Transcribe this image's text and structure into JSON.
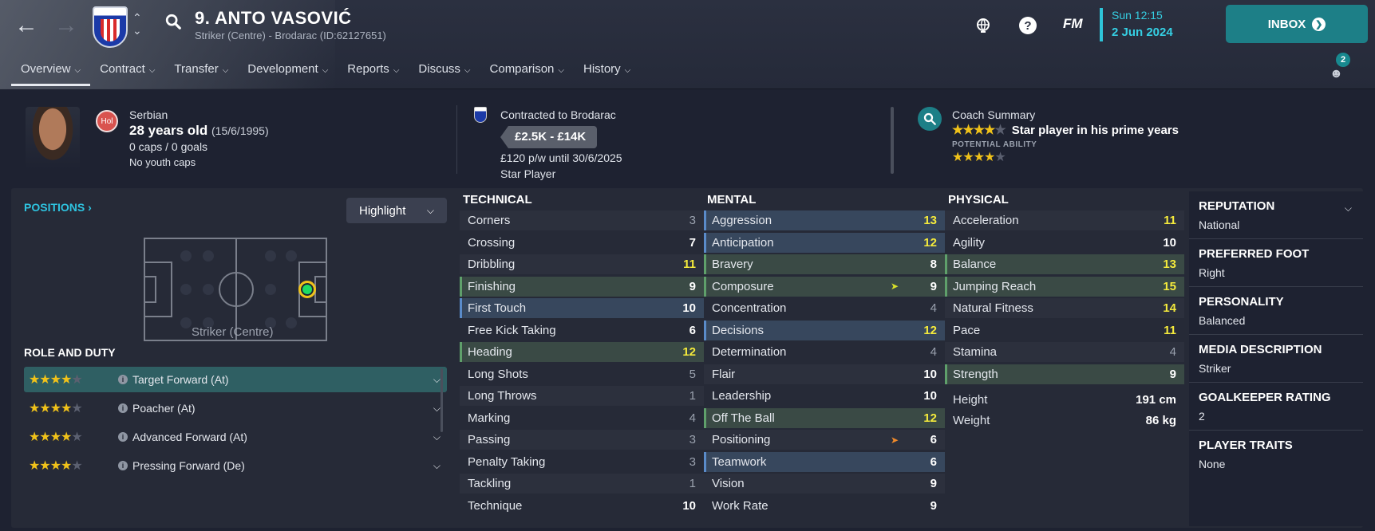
{
  "header": {
    "player_name": "9. ANTO VASOVIĆ",
    "player_sub": "Striker (Centre) - Brodarac (ID:62127651)",
    "fm_label": "FM",
    "time": "Sun 12:15",
    "date": "2 Jun 2024",
    "inbox_label": "INBOX",
    "notif_count": "2",
    "tabs": [
      {
        "label": "Overview"
      },
      {
        "label": "Contract"
      },
      {
        "label": "Transfer"
      },
      {
        "label": "Development"
      },
      {
        "label": "Reports"
      },
      {
        "label": "Discuss"
      },
      {
        "label": "Comparison"
      },
      {
        "label": "History"
      }
    ]
  },
  "summary": {
    "flag_code": "Hol",
    "nationality": "Serbian",
    "age": "28 years old",
    "dob": "(15/6/1995)",
    "caps": "0 caps / 0 goals",
    "youth": "No youth caps",
    "contract": "Contracted to Brodarac",
    "wage_range": "£2.5K - £14K",
    "wage_line": "£120 p/w until 30/6/2025",
    "status": "Star Player",
    "coach_title": "Coach Summary",
    "coach_stars": "★★★★",
    "coach_text": "Star player in his prime years",
    "potential_label": "POTENTIAL ABILITY",
    "potential_stars": "★★★★"
  },
  "positions": {
    "title": "POSITIONS",
    "highlight_label": "Highlight",
    "position_label": "Striker (Centre)",
    "role_title": "ROLE AND DUTY",
    "roles": [
      {
        "label": "Target Forward (At)",
        "stars": "★★★★"
      },
      {
        "label": "Poacher (At)",
        "stars": "★★★★"
      },
      {
        "label": "Advanced Forward (At)",
        "stars": "★★★★"
      },
      {
        "label": "Pressing Forward (De)",
        "stars": "★★★★"
      }
    ]
  },
  "technical": {
    "title": "TECHNICAL",
    "attrs": [
      {
        "name": "Corners",
        "value": "3"
      },
      {
        "name": "Crossing",
        "value": "7"
      },
      {
        "name": "Dribbling",
        "value": "11"
      },
      {
        "name": "Finishing",
        "value": "9"
      },
      {
        "name": "First Touch",
        "value": "10"
      },
      {
        "name": "Free Kick Taking",
        "value": "6"
      },
      {
        "name": "Heading",
        "value": "12"
      },
      {
        "name": "Long Shots",
        "value": "5"
      },
      {
        "name": "Long Throws",
        "value": "1"
      },
      {
        "name": "Marking",
        "value": "4"
      },
      {
        "name": "Passing",
        "value": "3"
      },
      {
        "name": "Penalty Taking",
        "value": "3"
      },
      {
        "name": "Tackling",
        "value": "1"
      },
      {
        "name": "Technique",
        "value": "10"
      }
    ]
  },
  "mental": {
    "title": "MENTAL",
    "attrs": [
      {
        "name": "Aggression",
        "value": "13"
      },
      {
        "name": "Anticipation",
        "value": "12"
      },
      {
        "name": "Bravery",
        "value": "8"
      },
      {
        "name": "Composure",
        "value": "9"
      },
      {
        "name": "Concentration",
        "value": "4"
      },
      {
        "name": "Decisions",
        "value": "12"
      },
      {
        "name": "Determination",
        "value": "4"
      },
      {
        "name": "Flair",
        "value": "10"
      },
      {
        "name": "Leadership",
        "value": "10"
      },
      {
        "name": "Off The Ball",
        "value": "12"
      },
      {
        "name": "Positioning",
        "value": "6"
      },
      {
        "name": "Teamwork",
        "value": "6"
      },
      {
        "name": "Vision",
        "value": "9"
      },
      {
        "name": "Work Rate",
        "value": "9"
      }
    ]
  },
  "physical": {
    "title": "PHYSICAL",
    "attrs": [
      {
        "name": "Acceleration",
        "value": "11"
      },
      {
        "name": "Agility",
        "value": "10"
      },
      {
        "name": "Balance",
        "value": "13"
      },
      {
        "name": "Jumping Reach",
        "value": "15"
      },
      {
        "name": "Natural Fitness",
        "value": "14"
      },
      {
        "name": "Pace",
        "value": "11"
      },
      {
        "name": "Stamina",
        "value": "4"
      },
      {
        "name": "Strength",
        "value": "9"
      }
    ],
    "height_label": "Height",
    "height": "191 cm",
    "weight_label": "Weight",
    "weight": "86 kg"
  },
  "info": {
    "reputation_label": "REPUTATION",
    "reputation": "National",
    "foot_label": "PREFERRED FOOT",
    "foot": "Right",
    "personality_label": "PERSONALITY",
    "personality": "Balanced",
    "media_label": "MEDIA DESCRIPTION",
    "media": "Striker",
    "gk_label": "GOALKEEPER RATING",
    "gk": "2",
    "traits_label": "PLAYER TRAITS",
    "traits": "None"
  }
}
